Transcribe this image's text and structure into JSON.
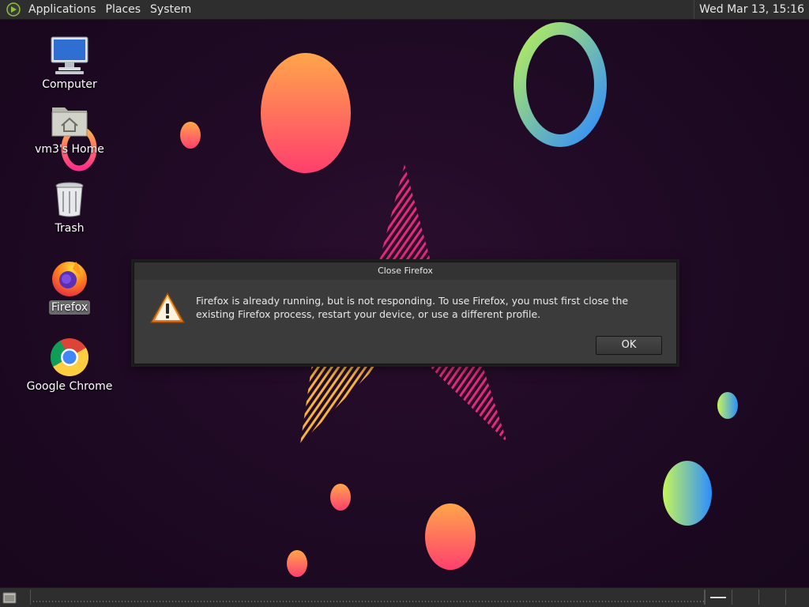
{
  "top_panel": {
    "menu": [
      "Applications",
      "Places",
      "System"
    ],
    "clock": "Wed Mar 13, 15:16"
  },
  "desktop": {
    "icons": [
      {
        "label": "Computer",
        "icon": "computer-icon"
      },
      {
        "label": "vm3's Home",
        "icon": "home-folder-icon"
      },
      {
        "label": "Trash",
        "icon": "trash-icon"
      },
      {
        "label": "Firefox",
        "icon": "firefox-icon",
        "selected": true
      },
      {
        "label": "Google Chrome",
        "icon": "chrome-icon"
      }
    ]
  },
  "dialog": {
    "title": "Close Firefox",
    "message": "Firefox is already running, but is not responding. To use Firefox, you must first close the existing Firefox process, restart your device, or use a different profile.",
    "ok_label": "OK",
    "icon": "warning-icon"
  },
  "bottom_panel": {
    "show_desktop_icon": "show-desktop-icon",
    "workspaces": 4
  }
}
